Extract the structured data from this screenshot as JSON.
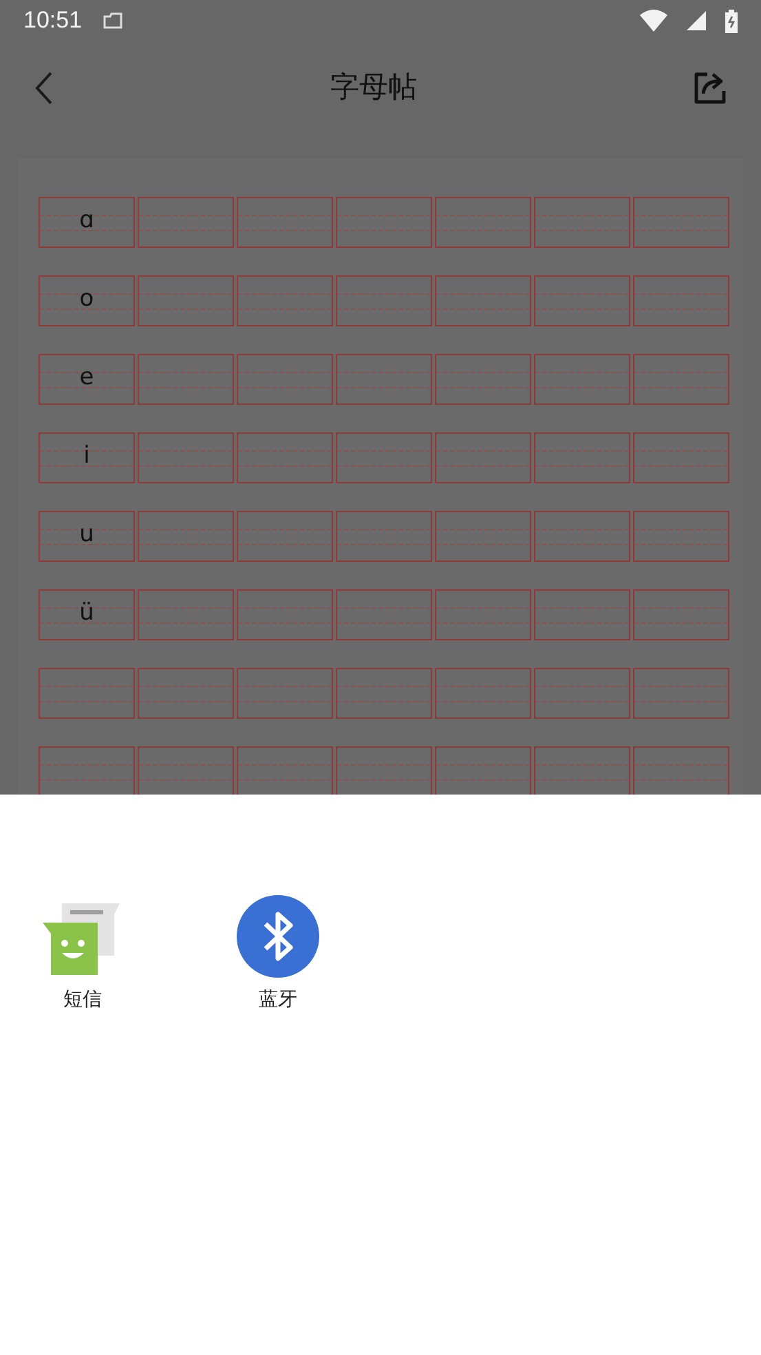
{
  "status_bar": {
    "time": "10:51"
  },
  "header": {
    "title": "字母帖"
  },
  "grid": {
    "rows": [
      {
        "kind": "letter",
        "letter": "ɑ"
      },
      {
        "kind": "letter",
        "letter": "o"
      },
      {
        "kind": "letter",
        "letter": "e"
      },
      {
        "kind": "letter",
        "letter": "i"
      },
      {
        "kind": "letter",
        "letter": "u"
      },
      {
        "kind": "letter",
        "letter": "ü"
      },
      {
        "kind": "blank"
      },
      {
        "kind": "blank"
      }
    ]
  },
  "share_sheet": {
    "targets": [
      {
        "kind": "messages",
        "label": "短信"
      },
      {
        "kind": "bluetooth",
        "label": "蓝牙"
      }
    ]
  }
}
